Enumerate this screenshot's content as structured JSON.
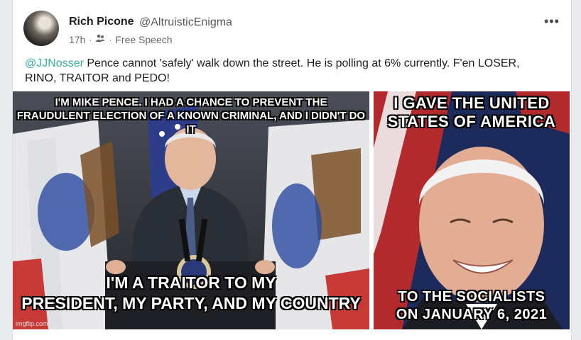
{
  "post": {
    "author_name": "Rich Picone",
    "author_handle": "@AltruisticEnigma",
    "time": "17h",
    "group": "Free Speech",
    "more_icon": "more-horizontal-icon",
    "mention": "@JJNosser",
    "text": " Pence cannot 'safely' walk down the street. He is polling at 6% currently. F'en LOSER, RINO, TRAITOR and PEDO!"
  },
  "images": {
    "left": {
      "top_caption": "I'M MIKE PENCE. I HAD A CHANCE TO PREVENT THE FRAUDULENT ELECTION OF A KNOWN CRIMINAL, AND I DIDN'T DO IT",
      "top_line1": "I'M MIKE PENCE. I HAD A CHANCE TO PREVENT THE",
      "top_line2": "FRAUDULENT ELECTION OF A KNOWN CRIMINAL, AND I DIDN'T DO IT",
      "bottom_line1": "I'M A TRAITOR TO MY",
      "bottom_line2": "PRESIDENT, MY PARTY, AND MY COUNTRY",
      "watermark": "imgflip.com"
    },
    "right": {
      "top_line1": "I GAVE THE UNITED",
      "top_line2": "STATES OF AMERICA",
      "bottom_line1": "TO THE SOCIALISTS",
      "bottom_line2": "ON JANUARY 6, 2021"
    }
  },
  "colors": {
    "mention": "#3ab09e",
    "background": "#e9ebee"
  }
}
